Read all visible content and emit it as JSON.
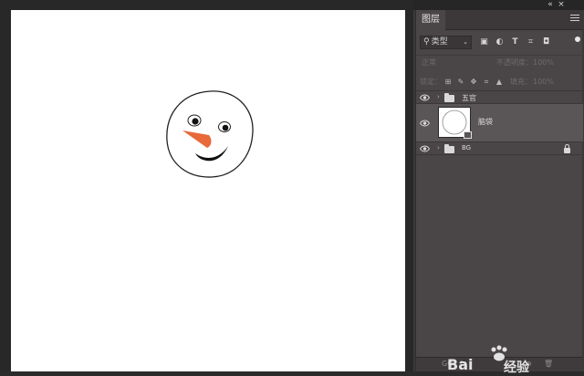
{
  "dock": {
    "collapse_label": "«",
    "close_label": "×"
  },
  "layers_panel": {
    "tab_label": "图层",
    "filter": {
      "icon": "search-icon",
      "value": "类型"
    },
    "filter_buttons": [
      "pixel-filter-icon",
      "adjustment-filter-icon",
      "type-filter-icon",
      "shape-filter-icon",
      "smartobject-filter-icon"
    ],
    "blend_mode": "正常",
    "opacity_label": "不透明度：",
    "opacity_value": "100%",
    "lock_label": "锁定：",
    "fill_label": "填充：",
    "fill_value": "100%",
    "layers": [
      {
        "name": "五官",
        "kind": "group",
        "visible": true,
        "selected": false
      },
      {
        "name": "脑袋",
        "kind": "smart-object",
        "visible": true,
        "selected": true
      },
      {
        "name": "BG",
        "kind": "group",
        "visible": true,
        "selected": false,
        "locked": true
      }
    ],
    "footer_link": "GO"
  },
  "canvas": {
    "background": "#ffffff",
    "nose_color": "#e8693a"
  },
  "watermark": {
    "text_a": "Bai",
    "text_b": "经验"
  }
}
